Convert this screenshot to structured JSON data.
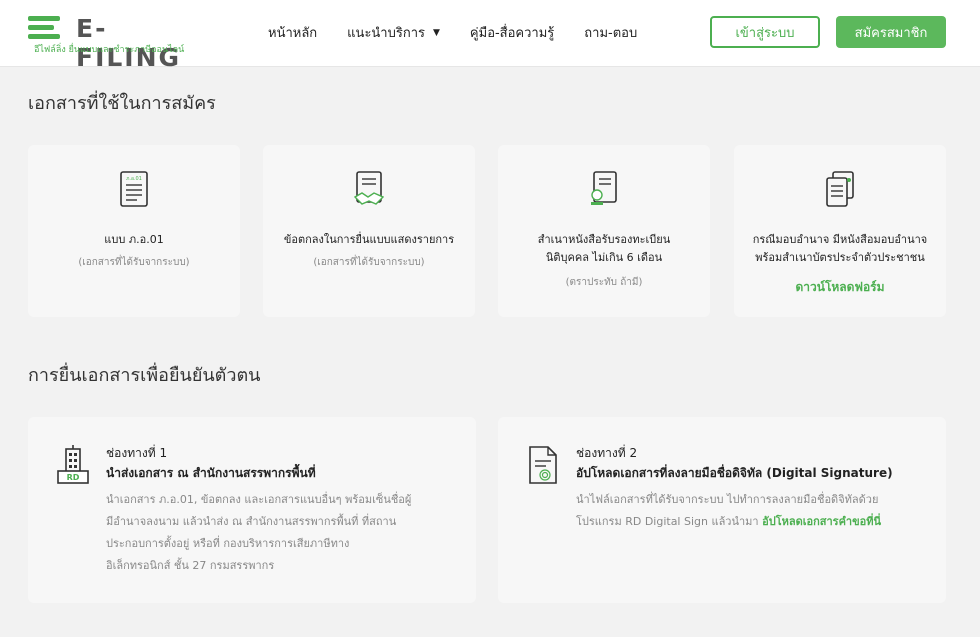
{
  "header": {
    "logo_text": "E-FILING",
    "logo_sub": "อีไฟล์ลิ่ง ยื่นแบบและชำระภาษีออนไลน์",
    "nav": [
      {
        "label": "หน้าหลัก"
      },
      {
        "label": "แนะนำบริการ"
      },
      {
        "label": "คู่มือ-สื่อความรู้"
      },
      {
        "label": "ถาม-ตอบ"
      }
    ],
    "login_label": "เข้าสู่ระบบ",
    "register_label": "สมัครสมาชิก"
  },
  "documents": {
    "title": "เอกสารที่ใช้ในการสมัคร",
    "cards": [
      {
        "title": "แบบ ภ.อ.01",
        "sub": "(เอกสารที่ได้รับจากระบบ)",
        "icon": "form-doc-icon",
        "doc_label": "ภ.อ.01"
      },
      {
        "title": "ข้อตกลงในการยื่นแบบแสดงรายการ",
        "sub": "(เอกสารที่ได้รับจากระบบ)",
        "icon": "agreement-icon"
      },
      {
        "title_line1": "สำเนาหนังสือรับรองทะเบียน",
        "title_line2": "นิติบุคคล ไม่เกิน 6 เดือน",
        "sub": "(ตราประทับ ถ้ามี)",
        "icon": "certificate-icon"
      },
      {
        "title_line1": "กรณีมอบอำนาจ มีหนังสือมอบอำนาจ",
        "title_line2": "พร้อมสำเนาบัตรประจำตัวประชาชน",
        "link": "ดาวน์โหลดฟอร์ม",
        "icon": "power-of-attorney-icon"
      }
    ]
  },
  "verification": {
    "title": "การยื่นเอกสารเพื่อยืนยันตัวตน",
    "channels": [
      {
        "label": "ช่องทางที่ 1",
        "heading": "นำส่งเอกสาร ณ สำนักงานสรรพากรพื้นที่",
        "icon": "office-building-icon",
        "icon_text": "RD",
        "lines": [
          "นำเอกสาร ภ.อ.01, ข้อตกลง และเอกสารแนบอื่นๆ พร้อมเซ็นชื่อผู้",
          "มีอำนาจลงนาม แล้วนำส่ง ณ สำนักงานสรรพากรพื้นที่ ที่สถาน",
          "ประกอบการตั้งอยู่ หรือที่ กองบริหารการเสียภาษีทาง",
          "อิเล็กทรอนิกส์ ชั้น 27 กรมสรรพากร"
        ]
      },
      {
        "label": "ช่องทางที่ 2",
        "heading": "อัปโหลดเอกสารที่ลงลายมือชื่อดิจิทัล (Digital Signature)",
        "icon": "digital-signature-doc-icon",
        "line1": "นำไฟล์เอกสารที่ได้รับจากระบบ ไปทำการลงลายมือชื่อดิจิทัลด้วย",
        "line2_prefix": "โปรแกรม RD Digital Sign แล้วนำมา ",
        "line2_link": "อัปโหลดเอกสารคำขอที่นี่"
      }
    ]
  },
  "colors": {
    "accent": "#4caf50",
    "button_fill": "#5cb85c",
    "background": "#f2f2f2",
    "card": "#f7f7f7"
  }
}
